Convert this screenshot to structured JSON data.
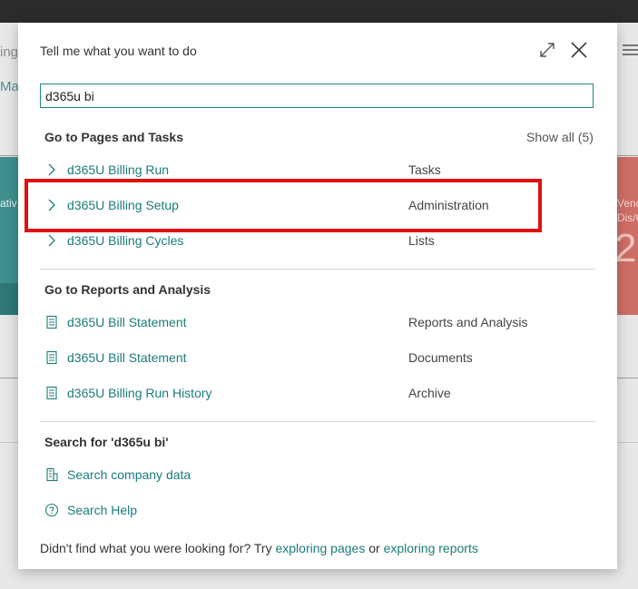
{
  "background": {
    "frag_top": "ing",
    "frag_link": "Man",
    "tile_left_text": "ativ",
    "tile_right_line1": "Vend",
    "tile_right_line2": "Dis/C",
    "tile_right_value": "2"
  },
  "dialog": {
    "title": "Tell me what you want to do",
    "search_value": "d365u bi"
  },
  "pages_section": {
    "title": "Go to Pages and Tasks",
    "show_all": "Show all (5)",
    "items": [
      {
        "label": "d365U Billing Run",
        "category": "Tasks"
      },
      {
        "label": "d365U Billing Setup",
        "category": "Administration"
      },
      {
        "label": "d365U Billing Cycles",
        "category": "Lists"
      }
    ]
  },
  "reports_section": {
    "title": "Go to Reports and Analysis",
    "items": [
      {
        "label": "d365U Bill Statement",
        "category": "Reports and Analysis"
      },
      {
        "label": "d365U Bill Statement",
        "category": "Documents"
      },
      {
        "label": "d365U Billing Run History",
        "category": "Archive"
      }
    ]
  },
  "search_section": {
    "title": "Search for 'd365u bi'",
    "company_data": "Search company data",
    "help": "Search Help"
  },
  "footer": {
    "prefix": "Didn't find what you were looking for? Try ",
    "link1": "exploring pages",
    "middle": " or ",
    "link2": "exploring reports"
  },
  "colors": {
    "accent": "#1a7c7a",
    "highlight": "#e01010",
    "tile_left": "#3f8f8f",
    "tile_right": "#cf6e66"
  }
}
